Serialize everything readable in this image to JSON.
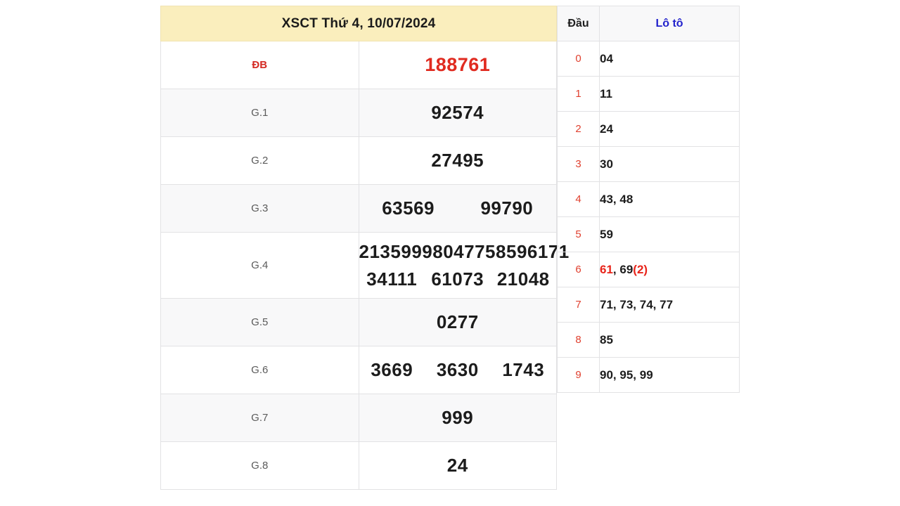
{
  "header": {
    "title": "XSCT Thứ 4, 10/07/2024",
    "background_color": "#faeebd"
  },
  "colors": {
    "special_red": "#e02b20",
    "label_red": "#d42a23",
    "dau_red": "#e0402f",
    "loto_blue": "#2222cc",
    "row_alt": "#f8f8f9",
    "border": "#e2e2e4"
  },
  "prizes": [
    {
      "label": "ĐB",
      "numbers": [
        [
          "188761"
        ]
      ],
      "special": true
    },
    {
      "label": "G.1",
      "numbers": [
        [
          "92574"
        ]
      ]
    },
    {
      "label": "G.2",
      "numbers": [
        [
          "27495"
        ]
      ]
    },
    {
      "label": "G.3",
      "numbers": [
        [
          "63569",
          "99790"
        ]
      ]
    },
    {
      "label": "G.4",
      "numbers": [
        [
          "21359",
          "99804",
          "77585",
          "96171"
        ],
        [
          "34111",
          "61073",
          "21048"
        ]
      ]
    },
    {
      "label": "G.5",
      "numbers": [
        [
          "0277"
        ]
      ]
    },
    {
      "label": "G.6",
      "numbers": [
        [
          "3669",
          "3630",
          "1743"
        ]
      ]
    },
    {
      "label": "G.7",
      "numbers": [
        [
          "999"
        ]
      ]
    },
    {
      "label": "G.8",
      "numbers": [
        [
          "24"
        ]
      ]
    }
  ],
  "loto": {
    "header_dau": "Đầu",
    "header_loto": "Lô tô",
    "rows": [
      {
        "dau": "0",
        "items": [
          {
            "text": "04",
            "highlight": false
          }
        ]
      },
      {
        "dau": "1",
        "items": [
          {
            "text": "11",
            "highlight": false
          }
        ]
      },
      {
        "dau": "2",
        "items": [
          {
            "text": "24",
            "highlight": false
          }
        ]
      },
      {
        "dau": "3",
        "items": [
          {
            "text": "30",
            "highlight": false
          }
        ]
      },
      {
        "dau": "4",
        "items": [
          {
            "text": "43",
            "highlight": false
          },
          {
            "text": "48",
            "highlight": false
          }
        ]
      },
      {
        "dau": "5",
        "items": [
          {
            "text": "59",
            "highlight": false
          }
        ]
      },
      {
        "dau": "6",
        "items": [
          {
            "text": "61",
            "highlight": true
          },
          {
            "text": "69",
            "highlight": false,
            "suffix": "(2)"
          }
        ]
      },
      {
        "dau": "7",
        "items": [
          {
            "text": "71",
            "highlight": false
          },
          {
            "text": "73",
            "highlight": false
          },
          {
            "text": "74",
            "highlight": false
          },
          {
            "text": "77",
            "highlight": false
          }
        ]
      },
      {
        "dau": "8",
        "items": [
          {
            "text": "85",
            "highlight": false
          }
        ]
      },
      {
        "dau": "9",
        "items": [
          {
            "text": "90",
            "highlight": false
          },
          {
            "text": "95",
            "highlight": false
          },
          {
            "text": "99",
            "highlight": false
          }
        ]
      }
    ]
  }
}
